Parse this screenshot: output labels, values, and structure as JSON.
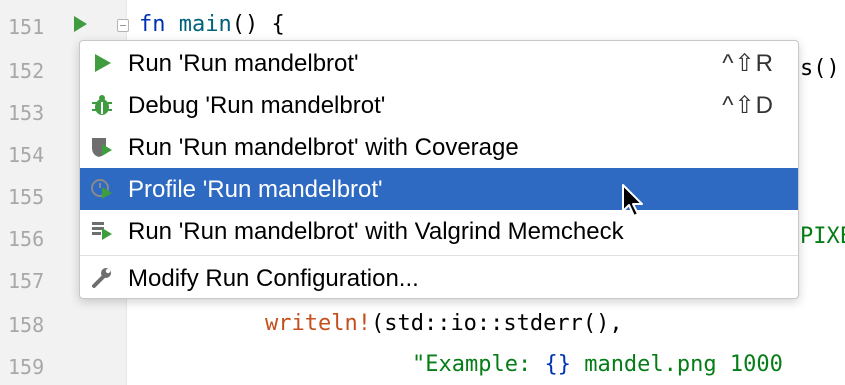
{
  "editor": {
    "line_numbers": [
      "151",
      "152",
      "153",
      "154",
      "155",
      "156",
      "157",
      "158",
      "159"
    ],
    "line151": {
      "kw": "fn",
      "name": "main",
      "rest": "() {"
    },
    "line152_tail": "s()",
    "line156_tail": "PIXE",
    "line158": {
      "macro": "writeln!",
      "rest": "(std::io::stderr(),"
    },
    "line159": {
      "str": "\"Example: ",
      "braces": "{}",
      "str_tail": " mandel.png 1000"
    }
  },
  "context_menu": {
    "items": [
      {
        "label": "Run 'Run mandelbrot'",
        "shortcut": "^⇧R",
        "icon": "run-icon"
      },
      {
        "label": "Debug 'Run mandelbrot'",
        "shortcut": "^⇧D",
        "icon": "debug-icon"
      },
      {
        "label": "Run 'Run mandelbrot' with Coverage",
        "shortcut": "",
        "icon": "coverage-icon"
      },
      {
        "label": "Profile 'Run mandelbrot'",
        "shortcut": "",
        "icon": "profile-icon",
        "selected": true
      },
      {
        "label": "Run 'Run mandelbrot' with Valgrind Memcheck",
        "shortcut": "",
        "icon": "valgrind-icon"
      },
      {
        "label": "Modify Run Configuration...",
        "shortcut": "",
        "icon": "wrench-icon"
      }
    ]
  },
  "colors": {
    "selection": "#2e6ac1",
    "run_green": "#3f9c3f",
    "keyword": "#0033b3",
    "macro": "#c4501e",
    "string": "#067d17"
  }
}
